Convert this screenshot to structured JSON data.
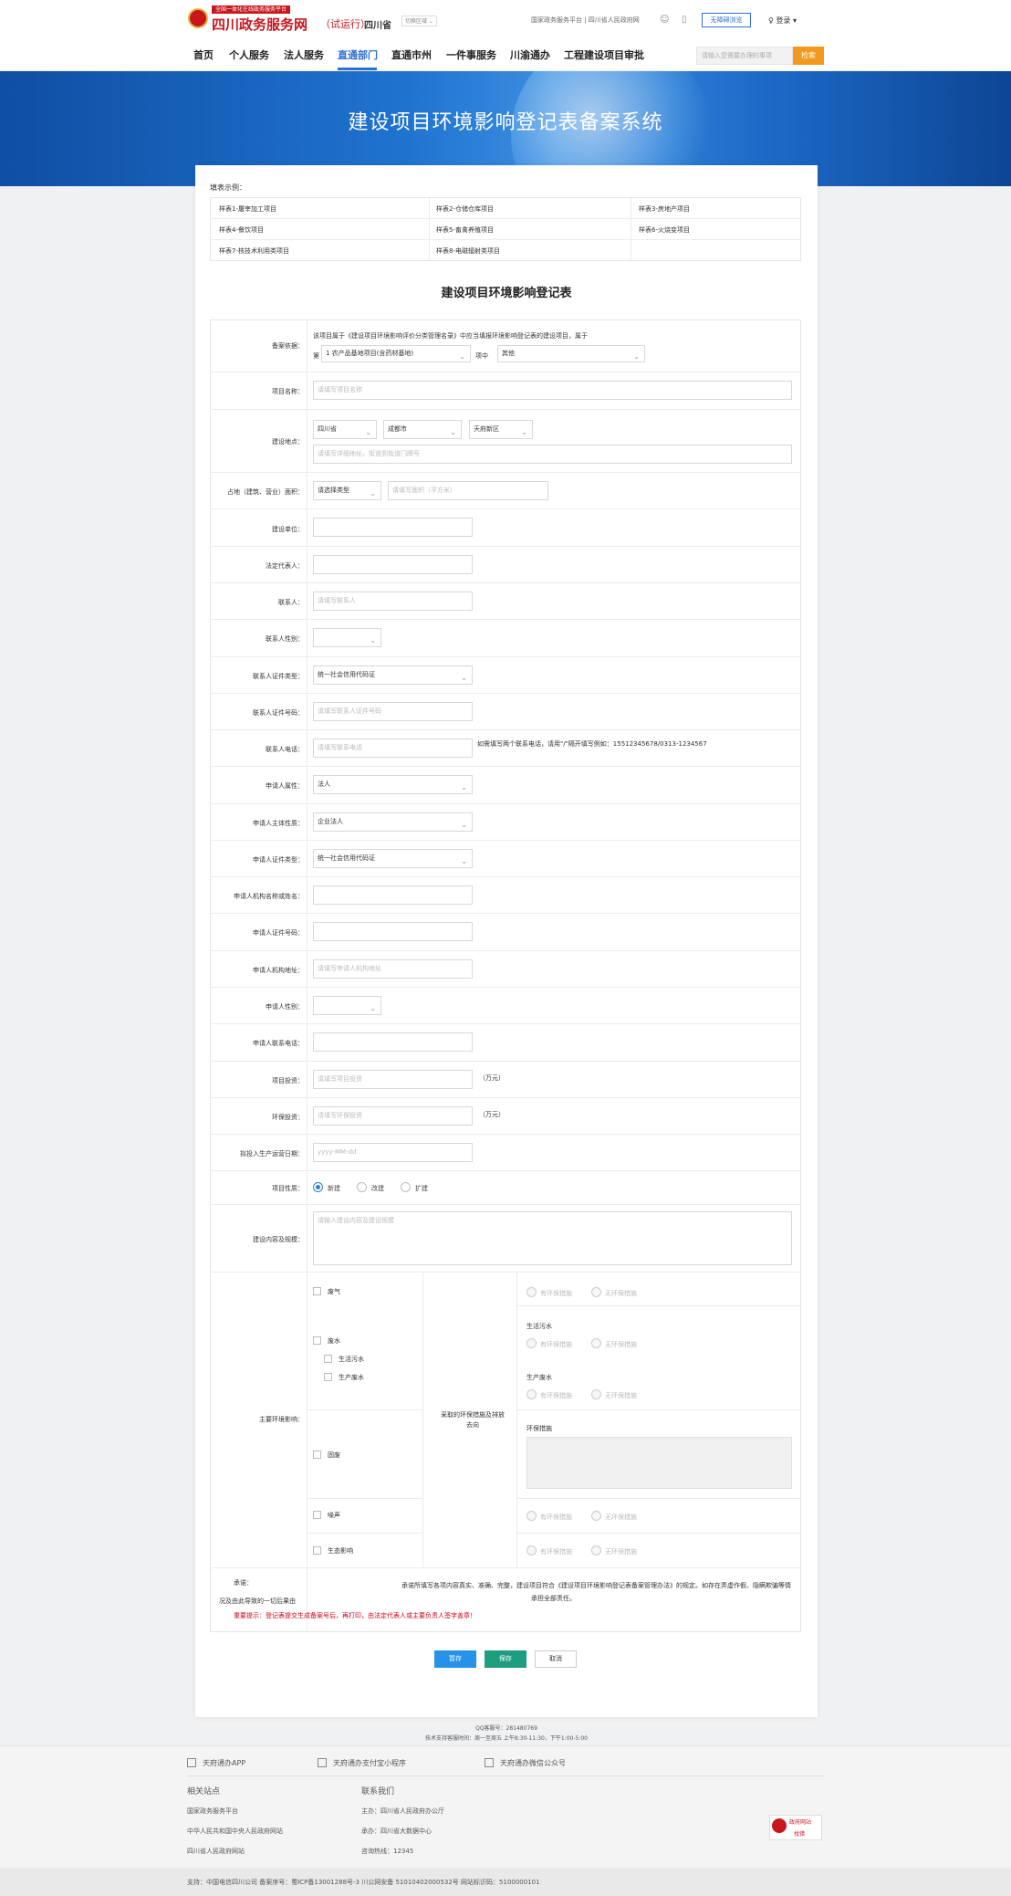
{
  "header": {
    "logo_tag": "全国一体化在线政务服务平台",
    "logo_main": "四川政务服务网",
    "logo_trial": "（试运行）",
    "logo_province": "四川省",
    "region_switch": "切换区域 ⌄",
    "top_links": "国家政务服务平台 | 四川省人民政府网",
    "barrier_free": "无障碍浏览",
    "login": "♀ 登录 ▾",
    "search_placeholder": "请输入您需要办理的事项",
    "search_button": "检索"
  },
  "nav": {
    "items": [
      "首页",
      "个人服务",
      "法人服务",
      "直通部门",
      "直通市州",
      "一件事服务",
      "川渝通办",
      "工程建设项目审批"
    ],
    "active_index": 3
  },
  "banner": {
    "title": "建设项目环境影响登记表备案系统"
  },
  "samples": {
    "label": "填表示例：",
    "items": [
      "样表1-屠宰加工项目",
      "样表2-仓储仓库项目",
      "样表3-房地产项目",
      "样表4-餐饮项目",
      "样表5-畜禽养殖项目",
      "样表6-火烧变项目",
      "样表7-核技术利用类项目",
      "样表8-电磁辐射类项目"
    ]
  },
  "form": {
    "title": "建设项目环境影响登记表",
    "basis_label": "备案依据：",
    "basis_text": "该项目属于《建设项目环境影响评价分类管理名录》中应当填报环境影响登记表的建设项目，属于",
    "basis_prefix": "第",
    "basis_select1": "1 农产品基地项目(含药材基地)",
    "basis_mid": "项中",
    "basis_select2": "其他",
    "project_name_label": "项目名称：",
    "project_name_placeholder": "请填写项目名称",
    "location_label": "建设地点：",
    "province": "四川省",
    "city": "成都市",
    "district": "天府新区",
    "address_placeholder": "请填写详细地址，街道到街道门牌号",
    "area_label": "占地（建筑、营业）面积：",
    "area_type_placeholder": "请选择类型",
    "area_value_placeholder": "请填写面积（平方米）",
    "unit_label": "建设单位：",
    "legal_rep_label": "法定代表人：",
    "contact_label": "联系人：",
    "contact_placeholder": "请填写联系人",
    "contact_gender_label": "联系人性别：",
    "contact_id_type_label": "联系人证件类型：",
    "contact_id_type_value": "统一社会信用代码证",
    "contact_id_no_label": "联系人证件号码：",
    "contact_id_no_placeholder": "请填写联系人证件号码",
    "contact_phone_label": "联系人电话：",
    "contact_phone_placeholder": "请填写联系电话",
    "contact_phone_hint": "如需填写两个联系电话，请用\"/\"隔开填写例如：15512345678/0313-1234567",
    "applicant_attr_label": "申请人属性：",
    "applicant_attr_value": "法人",
    "applicant_subject_label": "申请人主体性质：",
    "applicant_subject_value": "企业法人",
    "applicant_id_type_label": "申请人证件类型：",
    "applicant_id_type_value": "统一社会信用代码证",
    "applicant_org_label": "申请人机构名称或姓名：",
    "applicant_id_no_label": "申请人证件号码：",
    "applicant_addr_label": "申请人机构地址：",
    "applicant_addr_placeholder": "请填写申请人机构地址",
    "applicant_gender_label": "申请人性别：",
    "applicant_phone_label": "申请人联系电话：",
    "investment_label": "项目投资：",
    "investment_placeholder": "请填写项目投资",
    "investment_unit": "（万元）",
    "env_investment_label": "环保投资：",
    "env_investment_placeholder": "请填写环保投资",
    "env_investment_unit": "（万元）",
    "start_date_label": "拟投入生产运营日期：",
    "start_date_placeholder": "yyyy-MM-dd",
    "nature_label": "项目性质：",
    "nature_options": [
      "新建",
      "改建",
      "扩建"
    ],
    "nature_selected": 0,
    "content_label": "建设内容及规模：",
    "content_placeholder": "请输入建设内容及建设规模",
    "impact_label": "主要环境影响：",
    "measures_label": "采取的环保措施及排放去向",
    "impacts": [
      "废气",
      "废水",
      "固废",
      "噪声",
      "生态影响"
    ],
    "water_subs": [
      "生活污水",
      "生产废水"
    ],
    "measure_options": [
      "有环保措施",
      "无环保措施"
    ],
    "water_sub_labels": [
      "生活污水",
      "生产废水"
    ],
    "solid_waste_measure_label": "环保措施",
    "commitment_title": "承诺：",
    "commitment_text": "承诺所填写各项内容真实、准确、完整，建设项目符合《建设项目环境影响登记表备案管理办法》的规定。如存在弄虚作假、隐瞒欺骗等情况及由此导致的一切后果由",
    "commitment_tail": "承担全部责任。",
    "important_tip": "重要提示：登记表提交生成备案号后，再打印，由法定代表人或主要负责人签字盖章！"
  },
  "buttons": {
    "draft": "暂存",
    "save": "保存",
    "cancel": "取消"
  },
  "support": {
    "qq": "QQ客服号：281480769",
    "hours": "技术支持客服时间：周一至周五 上午8:30-11:30，下午1:00-5:00"
  },
  "footer": {
    "apps": [
      "天府通办APP",
      "天府通办支付宝小程序",
      "天府通办微信公众号"
    ],
    "related_title": "相关站点",
    "related": [
      "国家政务服务平台",
      "中华人民共和国中央人民政府网站",
      "四川省人民政府网站"
    ],
    "contact_title": "联系我们",
    "contact": [
      "主办：四川省人民政府办公厅",
      "承办：四川省大数据中心",
      "咨询热线：12345"
    ],
    "badge_line1": "政府网站",
    "badge_line2": "找错",
    "copyright": "支持：中国电信四川公司  备案序号：蜀ICP备13001288号-3  川公网安备 51010402000532号  网站标识码：5100000101"
  }
}
